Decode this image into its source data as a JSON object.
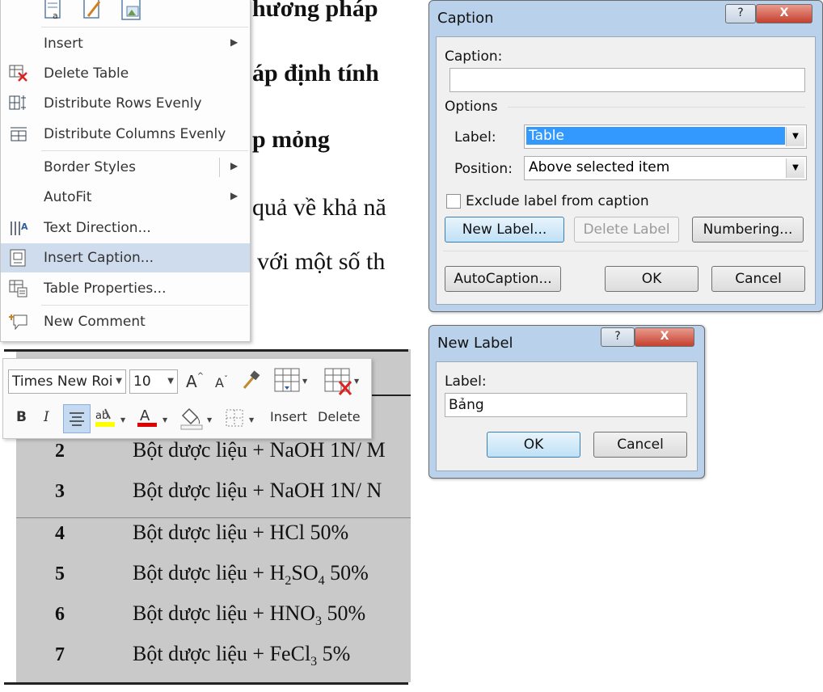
{
  "document": {
    "heading_lines": [
      "hương pháp",
      "áp định tính",
      "p mỏng"
    ],
    "body_lines": [
      "quả về khả nă",
      "với một số th"
    ],
    "rows": [
      {
        "num": "2",
        "text": "Bột dược liệu + NaOH 1N/ M"
      },
      {
        "num": "3",
        "text": "Bột dược liệu + NaOH 1N/ N"
      },
      {
        "num": "4",
        "text": "Bột dược liệu + HCl 50%"
      },
      {
        "num": "5",
        "pre": "Bột dược liệu + H",
        "s1": "2",
        "mid": "SO",
        "s2": "4",
        "post": " 50%"
      },
      {
        "num": "6",
        "pre": "Bột dược liệu + HNO",
        "s1": "3",
        "post": " 50%"
      },
      {
        "num": "7",
        "pre": "Bột dược liệu + FeCl",
        "s1": "3",
        "post": " 5%"
      }
    ]
  },
  "context_menu": {
    "items": [
      {
        "label": "Insert",
        "icon": "insert-icon",
        "submenu": true
      },
      {
        "label": "Delete Table",
        "icon": "delete-table-icon"
      },
      {
        "label": "Distribute Rows Evenly",
        "icon": "distribute-rows-icon"
      },
      {
        "label": "Distribute Columns Evenly",
        "icon": "distribute-columns-icon"
      },
      {
        "label": "Border Styles",
        "icon": "",
        "submenu": true
      },
      {
        "label": "AutoFit",
        "icon": "",
        "submenu": true
      },
      {
        "label": "Text Direction...",
        "icon": "text-direction-icon"
      },
      {
        "label": "Insert Caption...",
        "icon": "insert-caption-icon",
        "highlighted": true
      },
      {
        "label": "Table Properties...",
        "icon": "table-properties-icon"
      },
      {
        "label": "New Comment",
        "icon": "new-comment-icon"
      }
    ]
  },
  "mini_toolbar": {
    "font_name": "Times New Roi",
    "font_size": "10",
    "bold": "B",
    "italic": "I",
    "insert_label": "Insert",
    "delete_label": "Delete",
    "font_color": "#e00000",
    "highlight_color": "#ffff00"
  },
  "caption_dialog": {
    "title": "Caption",
    "caption_label": "Caption:",
    "caption_value": "",
    "options_label": "Options",
    "label_label": "Label:",
    "label_value": "Table",
    "position_label": "Position:",
    "position_value": "Above selected item",
    "exclude_label": "Exclude label from caption",
    "exclude_checked": false,
    "new_label_btn": "New Label...",
    "delete_label_btn": "Delete Label",
    "numbering_btn": "Numbering...",
    "autocaption_btn": "AutoCaption...",
    "ok_btn": "OK",
    "cancel_btn": "Cancel",
    "help_btn": "?",
    "close_btn": "X"
  },
  "new_label_dialog": {
    "title": "New Label",
    "label_label": "Label:",
    "label_value": "Bảng",
    "ok_btn": "OK",
    "cancel_btn": "Cancel",
    "help_btn": "?",
    "close_btn": "X"
  },
  "colors": {
    "dialog_frame": "#b9d1ea",
    "menu_highlight": "#cfdcee",
    "selection": "#3399ff",
    "table_shade": "#c9c9c9"
  }
}
